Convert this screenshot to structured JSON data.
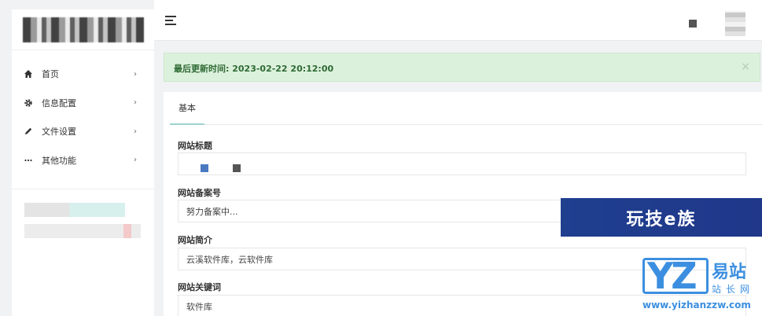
{
  "sidebar": {
    "items": [
      {
        "label": "首页",
        "icon": "home-icon"
      },
      {
        "label": "信息配置",
        "icon": "gear-icon"
      },
      {
        "label": "文件设置",
        "icon": "pencil-icon"
      },
      {
        "label": "其他功能",
        "icon": "ellipsis-icon"
      }
    ],
    "chevron": "›"
  },
  "topbar": {
    "menu_icon": "hamburger-icon"
  },
  "alert": {
    "text": "最后更新时间: 2023-02-22 20:12:00",
    "close": "×",
    "color": "#dcf1dc"
  },
  "tabs": [
    {
      "label": "基本",
      "active": true
    }
  ],
  "form": {
    "site_title_label": "网站标题",
    "site_title_value": "",
    "icp_label": "网站备案号",
    "icp_value": "努力备案中...",
    "intro_label": "网站简介",
    "intro_value": "云溪软件库，云软件库",
    "keywords_label": "网站关键词",
    "keywords_value": "软件库"
  },
  "watermarks": {
    "wm1": "玩技e族",
    "wm2_logo": "YZ",
    "wm2_title": "易站",
    "wm2_subtitle": "站长网",
    "wm2_url": "www.yizhanzzw.com"
  }
}
